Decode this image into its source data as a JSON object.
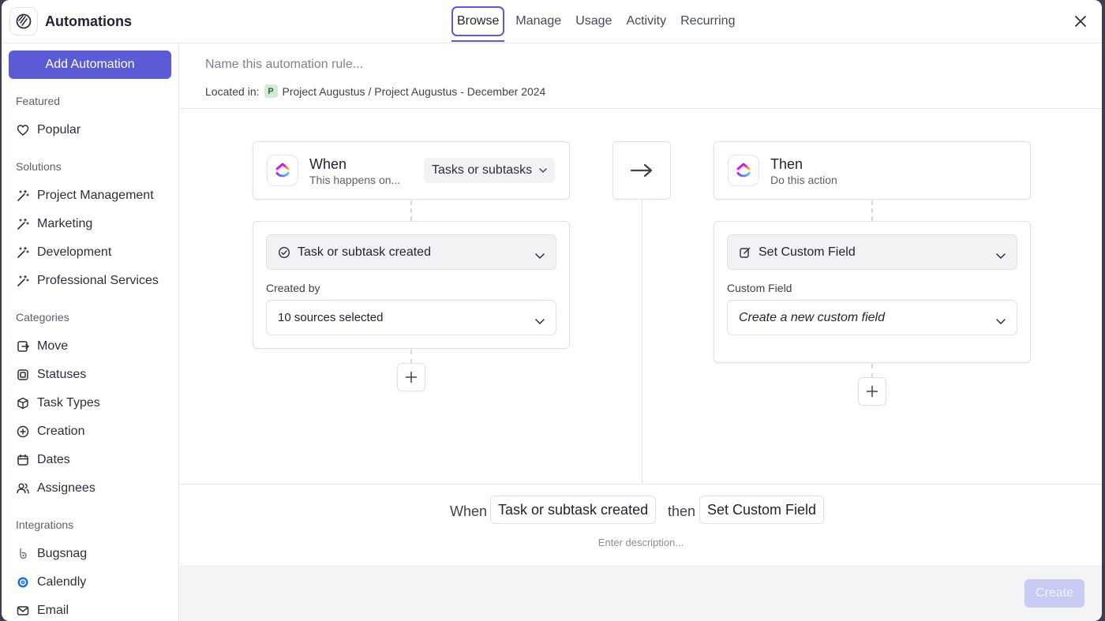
{
  "header": {
    "app_title": "Automations",
    "tabs": [
      {
        "label": "Browse",
        "active": true
      },
      {
        "label": "Manage"
      },
      {
        "label": "Usage"
      },
      {
        "label": "Activity"
      },
      {
        "label": "Recurring"
      }
    ]
  },
  "sidebar": {
    "add_button": "Add Automation",
    "sections": {
      "featured": "Featured",
      "solutions": "Solutions",
      "categories": "Categories",
      "integrations": "Integrations"
    },
    "featured_items": [
      {
        "label": "Popular",
        "icon": "heart-icon"
      }
    ],
    "solution_items": [
      {
        "label": "Project Management",
        "icon": "magic-wand-icon"
      },
      {
        "label": "Marketing",
        "icon": "magic-wand-icon"
      },
      {
        "label": "Development",
        "icon": "magic-wand-icon"
      },
      {
        "label": "Professional Services",
        "icon": "magic-wand-icon"
      }
    ],
    "category_items": [
      {
        "label": "Move",
        "icon": "move-icon"
      },
      {
        "label": "Statuses",
        "icon": "status-icon"
      },
      {
        "label": "Task Types",
        "icon": "cube-icon"
      },
      {
        "label": "Creation",
        "icon": "plus-circle-icon"
      },
      {
        "label": "Dates",
        "icon": "calendar-icon"
      },
      {
        "label": "Assignees",
        "icon": "users-icon"
      }
    ],
    "integration_items": [
      {
        "label": "Bugsnag",
        "icon": "bugsnag-icon"
      },
      {
        "label": "Calendly",
        "icon": "calendly-icon"
      },
      {
        "label": "Email",
        "icon": "mail-icon"
      }
    ]
  },
  "rule": {
    "name_placeholder": "Name this automation rule...",
    "located_label": "Located in:",
    "location_badge": "P",
    "location_path": "Project Augustus / Project Augustus - December 2024"
  },
  "trigger": {
    "title": "When",
    "subtitle": "This happens on...",
    "scope": "Tasks or subtasks",
    "event": "Task or subtask created",
    "created_by_label": "Created by",
    "created_by_value": "10 sources selected"
  },
  "action": {
    "title": "Then",
    "subtitle": "Do this action",
    "action_value": "Set Custom Field",
    "field_label": "Custom Field",
    "field_value": "Create a new custom field"
  },
  "summary": {
    "when": "When",
    "trigger": "Task or subtask created",
    "then": "then",
    "action": "Set Custom Field",
    "description_placeholder": "Enter description..."
  },
  "footer": {
    "create_label": "Create"
  },
  "colors": {
    "accent": "#5b5bd6",
    "create_disabled": "#c9cbf3"
  }
}
